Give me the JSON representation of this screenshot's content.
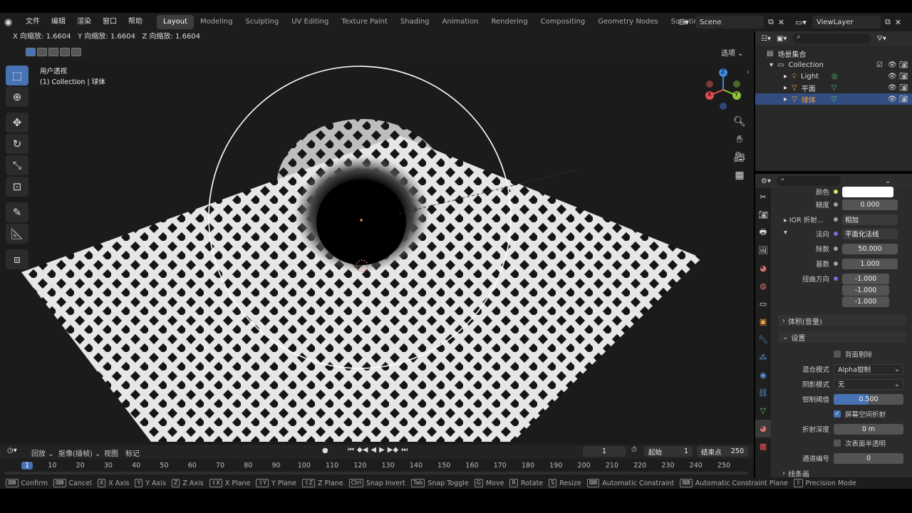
{
  "menu": {
    "items": [
      "文件",
      "编辑",
      "渲染",
      "窗口",
      "帮助"
    ]
  },
  "workspaces": [
    "Layout",
    "Modeling",
    "Sculpting",
    "UV Editing",
    "Texture Paint",
    "Shading",
    "Animation",
    "Rendering",
    "Compositing",
    "Geometry Nodes",
    "Scripting"
  ],
  "active_workspace": "Layout",
  "add_workspace": "+",
  "scene": {
    "name": "Scene"
  },
  "view_layer": {
    "name": "ViewLayer"
  },
  "operator_info": "X 向缩放: 1.6604   Y 向缩放: 1.6604   Z 向缩放: 1.6604",
  "options_label": "选项",
  "viewport": {
    "view_name": "用户透视",
    "collection_info": "(1) Collection | 球体",
    "gizmo": {
      "x": "X",
      "y": "Y",
      "z": "Z"
    }
  },
  "outliner": {
    "root": "场景集合",
    "collection": "Collection",
    "items": [
      "Light",
      "平面",
      "球体"
    ]
  },
  "properties": {
    "color_label": "颜色",
    "roughness_label": "糙度",
    "roughness_value": "0.000",
    "ior_label": "IOR 折射...",
    "ior_value": "相加",
    "normal_label": "法向",
    "normal_value": "平面化法线",
    "divisor_label": "除数",
    "divisor_value": "50.000",
    "base_label": "基数",
    "base_value": "1.000",
    "distort_label": "扭曲方向",
    "distort_values": [
      "-1.000",
      "-1.000",
      "-1.000"
    ],
    "volume_panel": "体积(音量)",
    "settings_panel": "设置",
    "backface_label": "背面剔除",
    "blend_mode_label": "混合模式",
    "blend_mode_value": "Alpha钳制",
    "shadow_mode_label": "阴影模式",
    "shadow_mode_value": "无",
    "clip_threshold_label": "钳制阈值",
    "clip_threshold_value": "0.500",
    "clip_threshold_fraction": 0.5,
    "ssr_label": "屏幕空间折射",
    "refraction_depth_label": "折射深度",
    "refraction_depth_value": "0 m",
    "subsurface_label": "次表面半透明",
    "pass_index_label": "通道编号",
    "pass_index_value": "0",
    "line_art_panel": "线条画"
  },
  "timeline": {
    "playback_label": "回放",
    "keying_label": "抠像(插帧)",
    "view_label": "视图",
    "marker_label": "标记",
    "current_frame": "1",
    "start_label": "起始",
    "start_value": "1",
    "end_label": "结束点",
    "end_value": "250",
    "ticks": [
      "1",
      "10",
      "20",
      "30",
      "40",
      "50",
      "60",
      "70",
      "80",
      "90",
      "100",
      "110",
      "120",
      "130",
      "140",
      "150",
      "160",
      "170",
      "180",
      "190",
      "200",
      "210",
      "220",
      "230",
      "240",
      "250"
    ]
  },
  "status_bar": [
    {
      "key": "",
      "label": "Confirm"
    },
    {
      "key": "",
      "label": "Cancel"
    },
    {
      "key": "X",
      "label": "X Axis"
    },
    {
      "key": "Y",
      "label": "Y Axis"
    },
    {
      "key": "Z",
      "label": "Z Axis"
    },
    {
      "key": "⇧X",
      "label": "X Plane"
    },
    {
      "key": "⇧Y",
      "label": "Y Plane"
    },
    {
      "key": "⇧Z",
      "label": "Z Plane"
    },
    {
      "key": "Ctrl",
      "label": "Snap Invert"
    },
    {
      "key": "Tab",
      "label": "Snap Toggle"
    },
    {
      "key": "G",
      "label": "Move"
    },
    {
      "key": "R",
      "label": "Rotate"
    },
    {
      "key": "S",
      "label": "Resize"
    },
    {
      "key": "",
      "label": "Automatic Constraint"
    },
    {
      "key": "",
      "label": "Automatic Constraint Plane"
    },
    {
      "key": "⇧",
      "label": "Precision Mode"
    }
  ],
  "colors": {
    "accent": "#4772b3",
    "selection": "#334d80",
    "gizmo_x": "#e34f4f",
    "gizmo_y": "#8bc33a",
    "gizmo_z": "#3d8ae0"
  }
}
